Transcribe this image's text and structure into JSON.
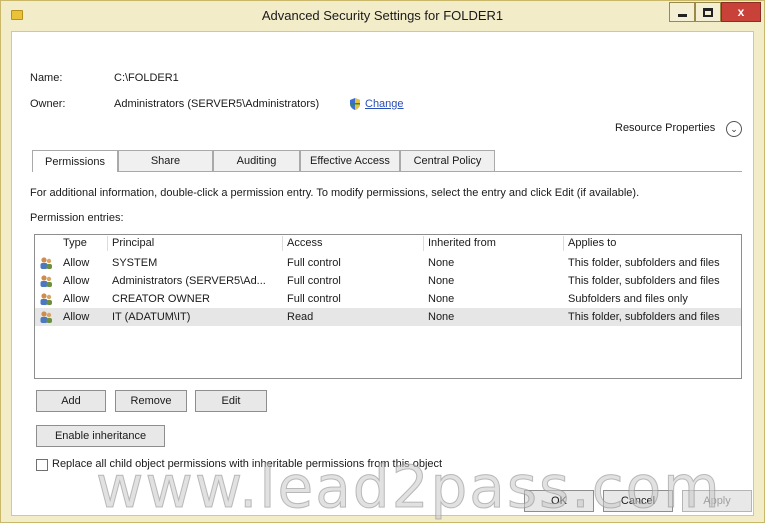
{
  "window": {
    "title": "Advanced Security Settings for FOLDER1",
    "controls": {
      "minimize_icon": "minimize-icon",
      "maximize_icon": "maximize-icon",
      "close_label": "x"
    }
  },
  "header": {
    "name_label": "Name:",
    "name_value": "C:\\FOLDER1",
    "owner_label": "Owner:",
    "owner_value": "Administrators (SERVER5\\Administrators)",
    "change_link": "Change",
    "resource_properties": "Resource Properties",
    "resource_properties_icon": "chevron-down-circle-icon"
  },
  "tabs": [
    "Permissions",
    "Share",
    "Auditing",
    "Effective Access",
    "Central Policy"
  ],
  "active_tab": "Permissions",
  "permissions": {
    "info_text": "For additional information, double-click a permission entry. To modify permissions, select the entry and click Edit (if available).",
    "entries_label": "Permission entries:",
    "columns": [
      "Type",
      "Principal",
      "Access",
      "Inherited from",
      "Applies to"
    ],
    "rows": [
      {
        "type": "Allow",
        "principal": "SYSTEM",
        "access": "Full control",
        "inherited": "None",
        "applies": "This folder, subfolders and files"
      },
      {
        "type": "Allow",
        "principal": "Administrators (SERVER5\\Ad...",
        "access": "Full control",
        "inherited": "None",
        "applies": "This folder, subfolders and files"
      },
      {
        "type": "Allow",
        "principal": "CREATOR OWNER",
        "access": "Full control",
        "inherited": "None",
        "applies": "Subfolders and files only"
      },
      {
        "type": "Allow",
        "principal": "IT (ADATUM\\IT)",
        "access": "Read",
        "inherited": "None",
        "applies": "This folder, subfolders and files"
      }
    ],
    "selected_row": 3
  },
  "buttons": {
    "add": "Add",
    "remove": "Remove",
    "edit": "Edit",
    "enable_inheritance": "Enable inheritance",
    "ok": "OK",
    "cancel": "Cancel",
    "apply": "Apply"
  },
  "replace_checkbox": {
    "label": "Replace all child object permissions with inheritable permissions from this object",
    "checked": false
  },
  "watermark": "www.lead2pass.com",
  "colors": {
    "title_bar": "#f2ecc9",
    "close_button": "#c8423a",
    "link": "#2a4fb8"
  }
}
